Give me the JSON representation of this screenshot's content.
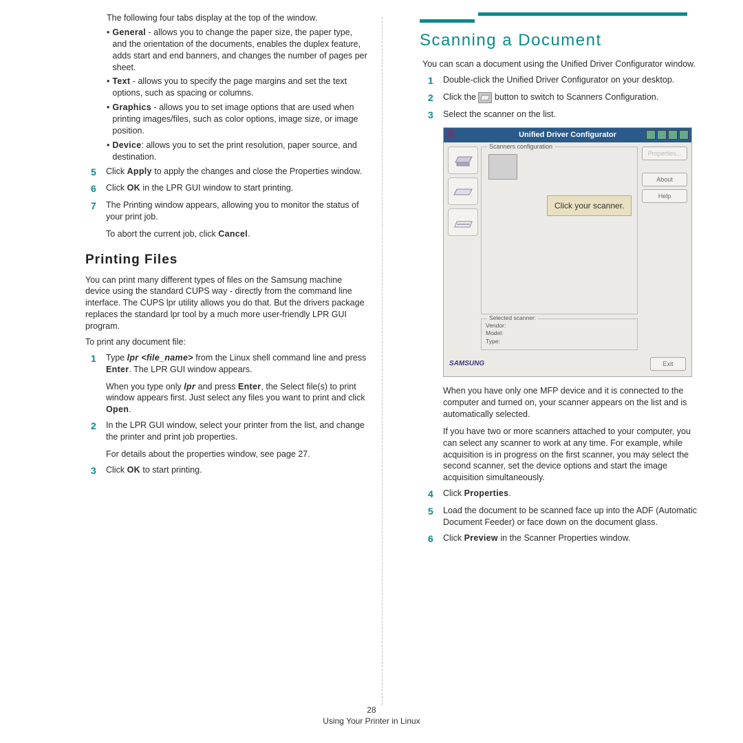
{
  "left": {
    "intro": "The following four tabs display at the top of the window.",
    "tabs": [
      {
        "label": "General",
        "desc": " - allows you to change the paper size, the paper type, and the orientation of the documents, enables the duplex feature, adds start and end banners, and changes the number of pages per sheet."
      },
      {
        "label": "Text",
        "desc": " - allows you to specify the page margins and set the text options, such as spacing or columns."
      },
      {
        "label": "Graphics",
        "desc": " - allows you to set image options that are used when printing images/files, such as color options, image size, or image position."
      },
      {
        "label": "Device",
        "desc": ": allows you to set the print resolution, paper source, and destination."
      }
    ],
    "step5": {
      "n": "5",
      "a": "Click ",
      "b": "Apply",
      "c": " to apply the changes and close the Properties window."
    },
    "step6": {
      "n": "6",
      "a": "Click ",
      "b": "OK",
      "c": " in the LPR GUI window to start printing."
    },
    "step7": {
      "n": "7",
      "t": "The Printing window appears, allowing you to monitor the status of your print job."
    },
    "step7_note_a": "To abort the current job, click ",
    "step7_note_b": "Cancel",
    "step7_note_c": ".",
    "h2": "Printing Files",
    "p1": "You can print many different types of files on the Samsung machine device using the standard CUPS way - directly from the command line interface. The CUPS lpr utility allows you do that. But the drivers package replaces the standard lpr tool by a much more user-friendly LPR GUI program.",
    "p2": "To print any document file:",
    "b_step1": {
      "n": "1",
      "a": "Type ",
      "cmd": "lpr <file_name>",
      "b": " from the Linux shell command line and press ",
      "c": "Enter",
      "d": ". The LPR GUI window appears."
    },
    "b_step1_note_a": "When you type only ",
    "b_step1_note_cmd": "lpr",
    "b_step1_note_b": " and press ",
    "b_step1_note_c": "Enter",
    "b_step1_note_d": ", the Select file(s) to print window appears first. Just select any files you want to print and click ",
    "b_step1_note_e": "Open",
    "b_step1_note_f": ".",
    "b_step2": {
      "n": "2",
      "t": "In the LPR GUI window, select your printer from the list, and change the printer and print job properties."
    },
    "b_step2_note": "For details about the properties window, see page 27.",
    "b_step3": {
      "n": "3",
      "a": "Click ",
      "b": "OK",
      "c": " to start printing."
    }
  },
  "right": {
    "h1": "Scanning a Document",
    "intro": "You can scan a document using the Unified Driver Configurator window.",
    "s1": {
      "n": "1",
      "t": "Double-click the Unified Driver Configurator on your desktop."
    },
    "s2": {
      "n": "2",
      "a": "Click the ",
      "b": " button to switch to Scanners Configuration."
    },
    "s3": {
      "n": "3",
      "t": "Select the scanner on the list."
    },
    "dlg": {
      "title": "Unified Driver Configurator",
      "fs_label": "Scanners configuration",
      "callout": "Click your scanner.",
      "btn_prop": "Properties...",
      "btn_about": "About",
      "btn_help": "Help",
      "sel_label": "Selected scanner:",
      "vendor": "Vendor:",
      "model": "Model:",
      "type": "Type:",
      "logo": "SAMSUNG",
      "exit": "Exit"
    },
    "after1": "When you have only one MFP device and it is connected to the computer and turned on, your scanner appears on the list and is automatically selected.",
    "after2": "If you have two or more scanners attached to your computer, you can select any scanner to work at any time. For example, while acquisition is in progress on the first scanner, you may select the second scanner, set the device options and start the image acquisition simultaneously.",
    "s4": {
      "n": "4",
      "a": "Click ",
      "b": "Properties",
      "c": "."
    },
    "s5": {
      "n": "5",
      "t": "Load the document to be scanned face up into the ADF (Automatic Document Feeder) or face down on the document glass."
    },
    "s6": {
      "n": "6",
      "a": "Click ",
      "b": "Preview",
      "c": " in the Scanner Properties window."
    }
  },
  "footer": {
    "page": "28",
    "chapter": "Using Your Printer in Linux"
  }
}
